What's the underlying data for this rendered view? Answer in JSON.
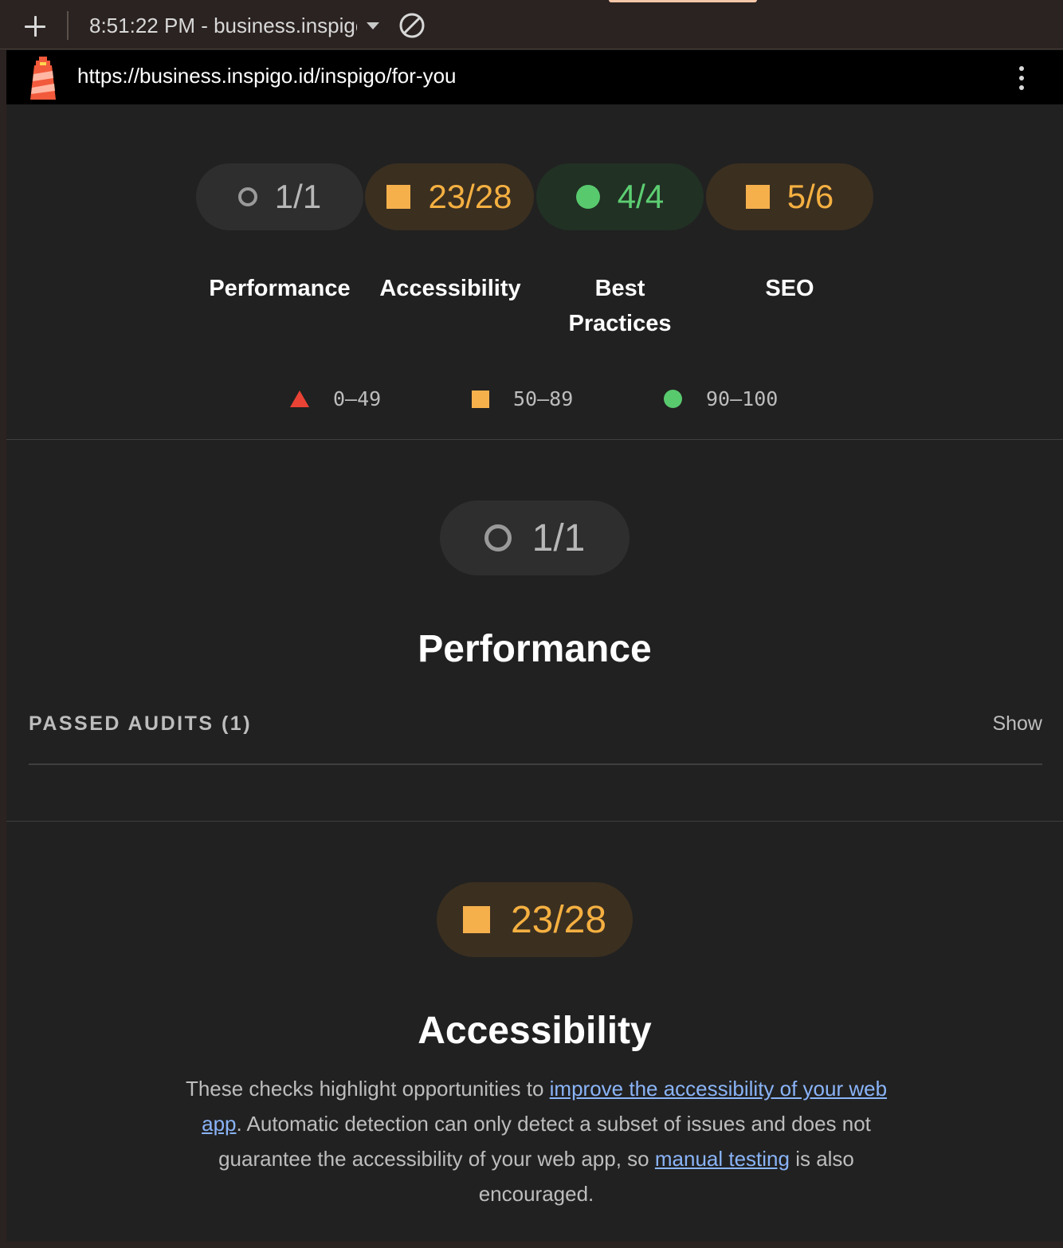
{
  "toolbar": {
    "new_report_icon": "plus-icon",
    "report_selector": "8:51:22 PM - business.inspigo.id",
    "clear_icon": "block-icon"
  },
  "urlbar": {
    "logo": "lighthouse-icon",
    "url": "https://business.inspigo.id/inspigo/for-you",
    "menu_icon": "more-vertical-icon"
  },
  "summary": {
    "gauges": [
      {
        "value": "1/1",
        "label": "Performance",
        "rating": "unscored"
      },
      {
        "value": "23/28",
        "label": "Accessibility",
        "rating": "average"
      },
      {
        "value": "4/4",
        "label": "Best Practices",
        "rating": "pass"
      },
      {
        "value": "5/6",
        "label": "SEO",
        "rating": "average"
      }
    ],
    "labels": {
      "performance": "Performance",
      "accessibility": "Accessibility",
      "best_line1": "Best",
      "best_line2": "Practices",
      "seo": "SEO"
    },
    "legend": [
      {
        "range": "0–49",
        "shape": "triangle",
        "color": "#ea4335"
      },
      {
        "range": "50–89",
        "shape": "square",
        "color": "#f5b04c"
      },
      {
        "range": "90–100",
        "shape": "circle",
        "color": "#59c96e"
      }
    ]
  },
  "performance_section": {
    "score": "1/1",
    "title": "Performance",
    "passed_audits": "PASSED AUDITS (1)",
    "show": "Show"
  },
  "accessibility_section": {
    "score": "23/28",
    "title": "Accessibility",
    "desc_1": "These checks highlight opportunities to ",
    "link_1": "improve the accessibility of your web app",
    "desc_2": ". Automatic detection can only detect a subset of issues and does not guarantee the accessibility of your web app, so ",
    "link_2": "manual testing",
    "desc_3": " is also encouraged."
  },
  "colors": {
    "toolbar_bg": "#2b2321",
    "page_bg": "#212121",
    "average": "#f5b04c",
    "pass": "#59c96e",
    "fail": "#ea4335",
    "link": "#8ab4f8"
  }
}
